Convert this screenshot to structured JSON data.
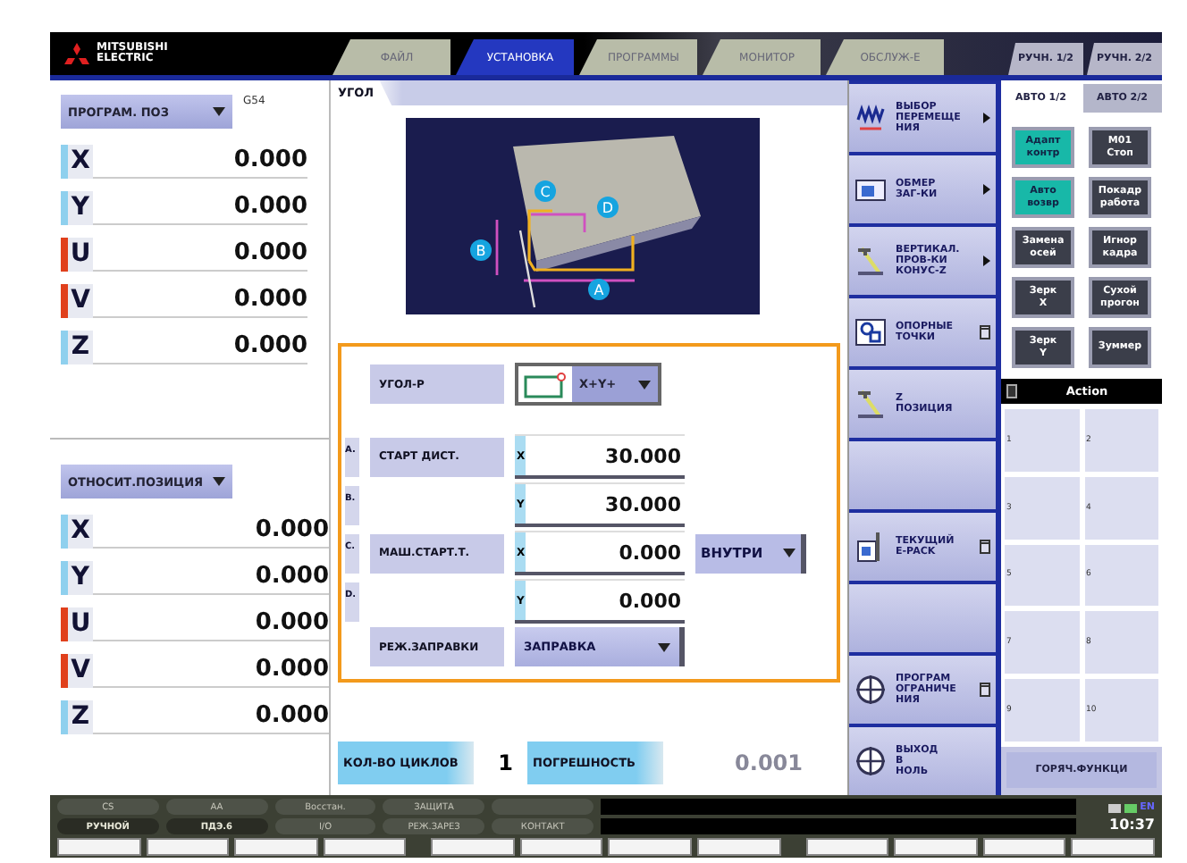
{
  "header": {
    "logo": "MITSUBISHI ELECTRIC",
    "tabs": [
      {
        "label": "ФАЙЛ",
        "selected": false
      },
      {
        "label": "УСТАНОВКА",
        "selected": true
      },
      {
        "label": "ПРОГРАММЫ",
        "selected": false
      },
      {
        "label": "МОНИТОР",
        "selected": false
      },
      {
        "label": "ОБСЛУЖ-Е",
        "selected": false
      }
    ],
    "mode_tabs": [
      {
        "label": "РУЧН. 1/2",
        "selected": false
      },
      {
        "label": "РУЧН. 2/2",
        "selected": false
      }
    ]
  },
  "positions": [
    {
      "selector": "ПРОГРАМ. ПОЗ",
      "code": "G54",
      "axes": [
        {
          "axis": "X",
          "value": "0.000",
          "color": "#8fd0ee"
        },
        {
          "axis": "Y",
          "value": "0.000",
          "color": "#8fd0ee"
        },
        {
          "axis": "U",
          "value": "0.000",
          "color": "#e0401c"
        },
        {
          "axis": "V",
          "value": "0.000",
          "color": "#e0401c"
        },
        {
          "axis": "Z",
          "value": "0.000",
          "color": "#8fd0ee"
        }
      ]
    },
    {
      "selector": "ОТНОСИТ.ПОЗИЦИЯ",
      "axes": [
        {
          "axis": "X",
          "value": "0.000",
          "color": "#8fd0ee"
        },
        {
          "axis": "Y",
          "value": "0.000",
          "color": "#8fd0ee"
        },
        {
          "axis": "U",
          "value": "0.000",
          "color": "#e0401c"
        },
        {
          "axis": "V",
          "value": "0.000",
          "color": "#e0401c"
        },
        {
          "axis": "Z",
          "value": "0.000",
          "color": "#8fd0ee"
        }
      ]
    }
  ],
  "page": {
    "title": "УГОЛ",
    "diagram": {
      "markers": [
        "A",
        "B",
        "C",
        "D"
      ]
    },
    "form": [
      {
        "kind": "pattern",
        "label": "УГОЛ-Р",
        "value": "X+Y+"
      },
      {
        "kind": "coord",
        "letter": "A.",
        "label": "СТАРТ ДИСТ.",
        "axis": "X",
        "value": "30.000"
      },
      {
        "kind": "coord",
        "letter": "B.",
        "axis": "Y",
        "value": "30.000"
      },
      {
        "kind": "coord",
        "letter": "C.",
        "label": "МАШ.СТАРТ.Т.",
        "axis": "X",
        "value": "0.000",
        "option": "ВНУТРИ"
      },
      {
        "kind": "coord",
        "letter": "D.",
        "axis": "Y",
        "value": "0.000"
      },
      {
        "kind": "select",
        "label": "РЕЖ.ЗАПРАВКИ",
        "value": "ЗАПРАВКА"
      }
    ],
    "cycles": {
      "label": "КОЛ-ВО ЦИКЛОВ",
      "value": "1"
    },
    "tolerance": {
      "label": "ПОГРЕШНОСТЬ",
      "value": "0.001"
    }
  },
  "menu": [
    {
      "lines": [
        "ВЫБОР",
        "ПЕРЕМЕЩЕ",
        "НИЯ"
      ],
      "kind": "wave",
      "submenu": true,
      "window": false
    },
    {
      "lines": [
        "ОБМЕР",
        "ЗАГ-КИ"
      ],
      "kind": "block",
      "submenu": true,
      "window": false
    },
    {
      "lines": [
        "ВЕРТИКАЛ.",
        "ПРОВ-КИ",
        "КОНУС-Z"
      ],
      "kind": "wire",
      "submenu": true,
      "window": false
    },
    {
      "lines": [
        "ОПОРНЫЕ",
        "ТОЧКИ"
      ],
      "kind": "points",
      "submenu": false,
      "window": true
    },
    {
      "lines": [
        "Z",
        "ПОЗИЦИЯ"
      ],
      "kind": "wire",
      "submenu": false,
      "window": false
    },
    {
      "kind": "blank"
    },
    {
      "lines": [
        "ТЕКУЩИЙ",
        "E-PACK"
      ],
      "kind": "epack",
      "submenu": false,
      "window": true
    },
    {
      "kind": "blank"
    },
    {
      "lines": [
        "ПРОГРАМ",
        "ОГРАНИЧЕ",
        "НИЯ"
      ],
      "kind": "target",
      "submenu": false,
      "window": true
    },
    {
      "lines": [
        "ВЫХОД",
        "В",
        "НОЛЬ"
      ],
      "kind": "target",
      "submenu": false,
      "window": false
    }
  ],
  "side": {
    "tabs": [
      {
        "label": "АВТО 1/2",
        "selected": true
      },
      {
        "label": "АВТО 2/2",
        "selected": false
      }
    ],
    "toggles": [
      {
        "lines": [
          "Адапт",
          "контр"
        ],
        "on": true
      },
      {
        "lines": [
          "M01",
          "Стоп"
        ],
        "on": false
      },
      {
        "lines": [
          "Авто",
          "возвр"
        ],
        "on": true
      },
      {
        "lines": [
          "Покадр",
          "работа"
        ],
        "on": false
      },
      {
        "lines": [
          "Замена",
          "осей"
        ],
        "on": false
      },
      {
        "lines": [
          "Игнор",
          "кадра"
        ],
        "on": false
      },
      {
        "lines": [
          "Зерк",
          "X"
        ],
        "on": false
      },
      {
        "lines": [
          "Сухой",
          "прогон"
        ],
        "on": false
      },
      {
        "lines": [
          "Зерк",
          "Y"
        ],
        "on": false
      },
      {
        "lines": [
          "Зуммер"
        ],
        "on": false
      }
    ],
    "action_title": "Action",
    "actions": [
      "1",
      "2",
      "3",
      "4",
      "5",
      "6",
      "7",
      "8",
      "9",
      "10"
    ],
    "hot": "ГОРЯЧ.ФУНКЦИ"
  },
  "status": {
    "lamps": [
      {
        "label": "CS",
        "on": false
      },
      {
        "label": "AA",
        "on": false
      },
      {
        "label": "Восстан.",
        "on": false
      },
      {
        "label": "ЗАЩИТА",
        "on": false
      },
      {
        "on": false
      },
      {
        "label": "РУЧНОЙ",
        "on": true
      },
      {
        "label": "ПДЭ.6",
        "on": true
      },
      {
        "label": "I/O",
        "on": false
      },
      {
        "label": "РЕЖ.ЗАРЕЗ",
        "on": false
      },
      {
        "label": "КОНТАКТ",
        "on": false
      }
    ],
    "language": "EN",
    "time": "10:37"
  }
}
